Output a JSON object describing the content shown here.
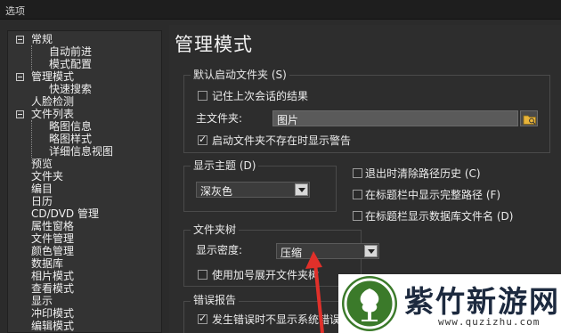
{
  "window": {
    "title": "选项"
  },
  "sidebar": {
    "items": [
      {
        "label": "常规",
        "expander": true
      },
      {
        "label": "自动前进"
      },
      {
        "label": "模式配置"
      },
      {
        "label": "管理模式",
        "expander": true
      },
      {
        "label": "快速搜索"
      },
      {
        "label": "人脸检测"
      },
      {
        "label": "文件列表",
        "expander": true
      },
      {
        "label": "略图信息"
      },
      {
        "label": "略图样式"
      },
      {
        "label": "详细信息视图"
      },
      {
        "label": "预览"
      },
      {
        "label": "文件夹"
      },
      {
        "label": "编目"
      },
      {
        "label": "日历"
      },
      {
        "label": "CD/DVD 管理"
      },
      {
        "label": "属性窗格"
      },
      {
        "label": "文件管理"
      },
      {
        "label": "颜色管理"
      },
      {
        "label": "数据库"
      },
      {
        "label": "相片模式"
      },
      {
        "label": "查看模式"
      },
      {
        "label": "显示"
      },
      {
        "label": "冲印模式"
      },
      {
        "label": "编辑模式"
      }
    ]
  },
  "main": {
    "title": "管理模式",
    "default_folder": {
      "group_label": "默认启动文件夹 (S)",
      "remember_label": "记住上次会话的结果",
      "remember_checked": false,
      "main_folder_label": "主文件夹:",
      "main_folder_value": "图片",
      "warn_label": "启动文件夹不存在时显示警告",
      "warn_checked": true
    },
    "theme": {
      "group_label": "显示主题 (D)",
      "value": "深灰色"
    },
    "right_options": [
      {
        "label": "退出时清除路径历史 (C)",
        "checked": false
      },
      {
        "label": "在标题栏中显示完整路径 (F)",
        "checked": false
      },
      {
        "label": "在标题栏显示数据库文件名 (D)",
        "checked": false
      }
    ],
    "folder_tree": {
      "group_label": "文件夹树",
      "density_label": "显示密度:",
      "density_value": "压缩",
      "plus_label": "使用加号展开文件夹树",
      "plus_checked": false
    },
    "errors": {
      "group_label": "错误报告",
      "suppress_label": "发生错误时不显示系统错误",
      "suppress_checked": true
    }
  },
  "watermark": {
    "title": "紫竹新游网",
    "url": "www.quzizhu.com",
    "accent": "#3b7a2a"
  },
  "colors": {
    "arrow": "#e0302a"
  }
}
